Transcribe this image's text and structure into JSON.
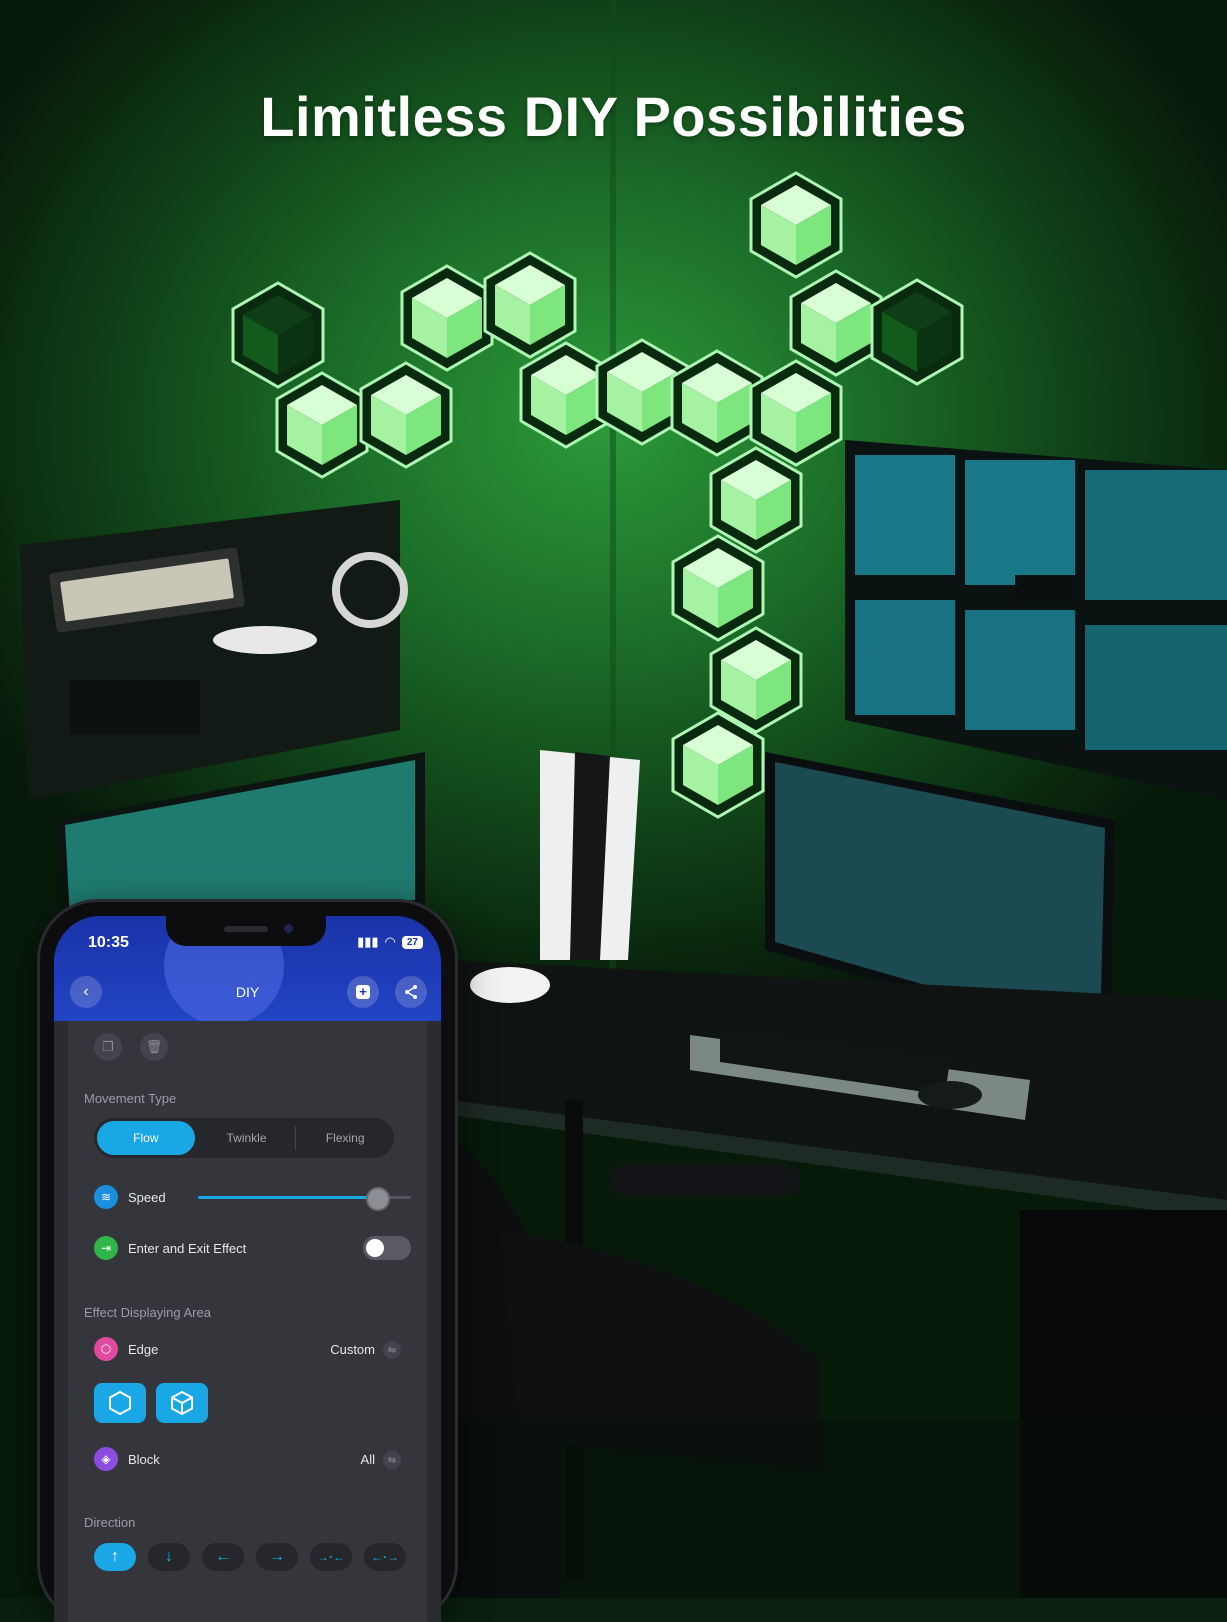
{
  "headline": "Limitless DIY Possibilities",
  "colors": {
    "accent": "#1aa7e6",
    "header_blue": "#2344c4",
    "panel_green": "#8ff59a",
    "speed_icon": "#1a8fe0",
    "enter_exit_icon": "#2fb54a",
    "edge_icon": "#e04a9e",
    "block_icon": "#8a4de0"
  },
  "phone": {
    "status_bar": {
      "time": "10:35",
      "battery": "27"
    },
    "header": {
      "title": "DIY",
      "back_icon": "chevron-left-icon",
      "add_icon": "add-square-icon",
      "share_icon": "share-icon"
    },
    "tools": {
      "copy_icon": "copy-icon",
      "delete_icon": "trash-icon"
    },
    "movement": {
      "label": "Movement Type",
      "options": [
        "Flow",
        "Twinkle",
        "Flexing"
      ],
      "selected": "Flow"
    },
    "speed": {
      "label": "Speed",
      "value_fraction": 0.84
    },
    "enter_exit": {
      "label": "Enter and Exit Effect",
      "enabled": false
    },
    "display_area": {
      "label": "Effect Displaying Area",
      "edge": {
        "label": "Edge",
        "value": "Custom"
      },
      "shape_icons": [
        "hexagon-outline-icon",
        "hexagon-cube-icon"
      ],
      "block": {
        "label": "Block",
        "value": "All"
      }
    },
    "direction": {
      "label": "Direction",
      "icons": [
        "arrow-up-icon",
        "arrow-down-icon",
        "arrow-left-icon",
        "arrow-right-icon",
        "gather-icon",
        "spread-icon"
      ],
      "selected_index": 0
    }
  }
}
